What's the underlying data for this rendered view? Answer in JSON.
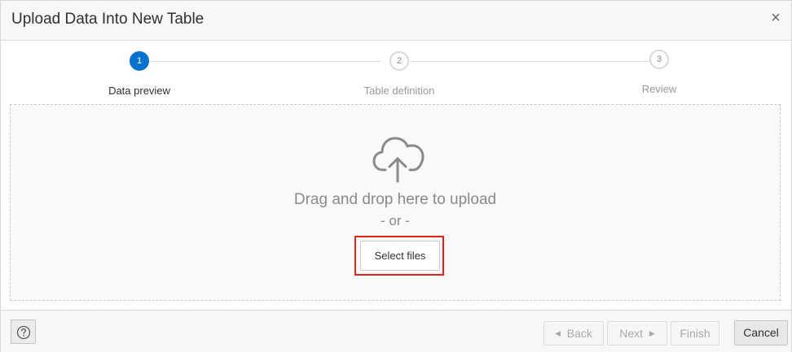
{
  "dialog": {
    "title": "Upload Data Into New Table",
    "close_label": "×"
  },
  "stepper": {
    "steps": [
      {
        "number": "1",
        "label": "Data preview",
        "state": "active"
      },
      {
        "number": "2",
        "label": "Table definition",
        "state": "inactive"
      },
      {
        "number": "3",
        "label": "Review",
        "state": "inactive"
      }
    ],
    "active_color": "#0572ce"
  },
  "dropzone": {
    "icon": "cloud-upload-icon",
    "drag_text": "Drag and drop here to upload",
    "or_text": "- or -",
    "select_label": "Select files",
    "highlight_color": "#e0241c"
  },
  "footer": {
    "help_icon": "help-icon",
    "back_label": "Back",
    "next_label": "Next",
    "finish_label": "Finish",
    "cancel_label": "Cancel"
  }
}
